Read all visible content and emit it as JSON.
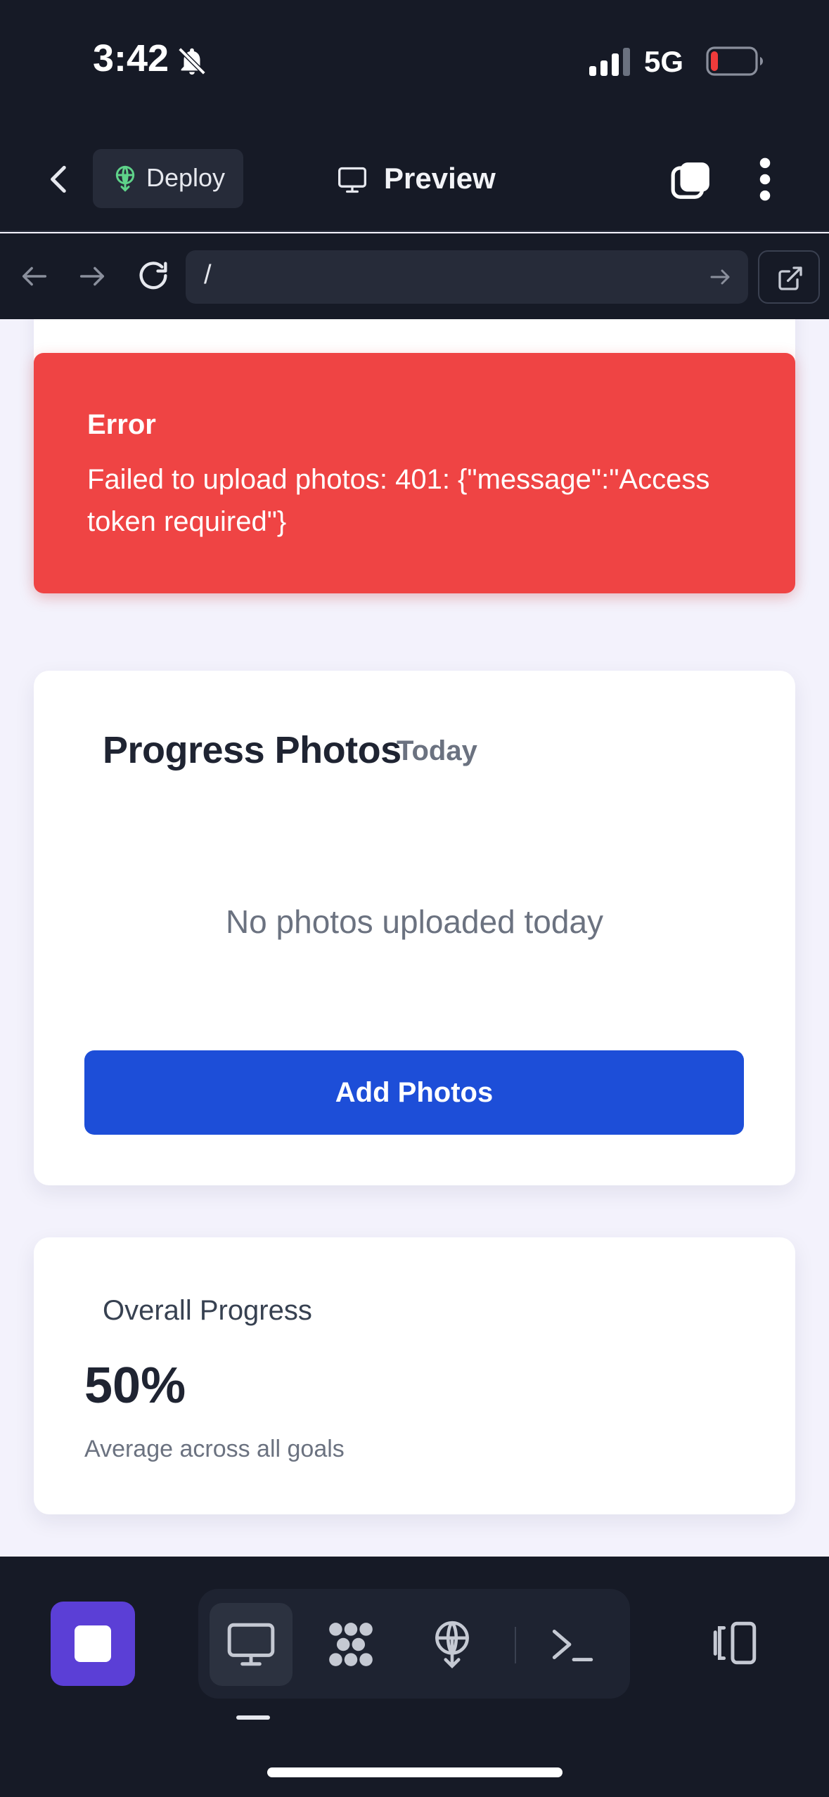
{
  "status_bar": {
    "time": "3:42",
    "network": "5G",
    "icons": [
      "bell-muted-icon",
      "signal-icon",
      "battery-icon"
    ]
  },
  "header": {
    "deploy_label": "Deploy",
    "preview_label": "Preview",
    "icons": [
      "back-chevron-icon",
      "deploy-icon",
      "monitor-icon",
      "tabs-icon",
      "kebab-menu-icon"
    ]
  },
  "urlbar": {
    "url": "/",
    "icons": [
      "nav-back-icon",
      "nav-forward-icon",
      "reload-icon",
      "url-go-icon",
      "open-external-icon"
    ]
  },
  "error": {
    "title": "Error",
    "message": "Failed to upload photos: 401: {\"message\":\"Access token required\"}"
  },
  "photos_card": {
    "title": "Progress Photos",
    "subtitle": "Today",
    "empty_text": "No photos uploaded today",
    "button_label": "Add Photos"
  },
  "overall_card": {
    "title": "Overall Progress",
    "value": "50%",
    "subtitle": "Average across all goals"
  },
  "bottom_toolbar": {
    "icons": [
      "stop-icon",
      "monitor-icon",
      "workflows-icon",
      "deploy-icon",
      "terminal-icon",
      "layout-icon"
    ]
  },
  "colors": {
    "chrome_bg": "#161a26",
    "error_bg": "#ef4444",
    "primary_button": "#1d4ed8",
    "stop_button": "#5b3fd6",
    "page_bg": "#f3f2fc"
  }
}
